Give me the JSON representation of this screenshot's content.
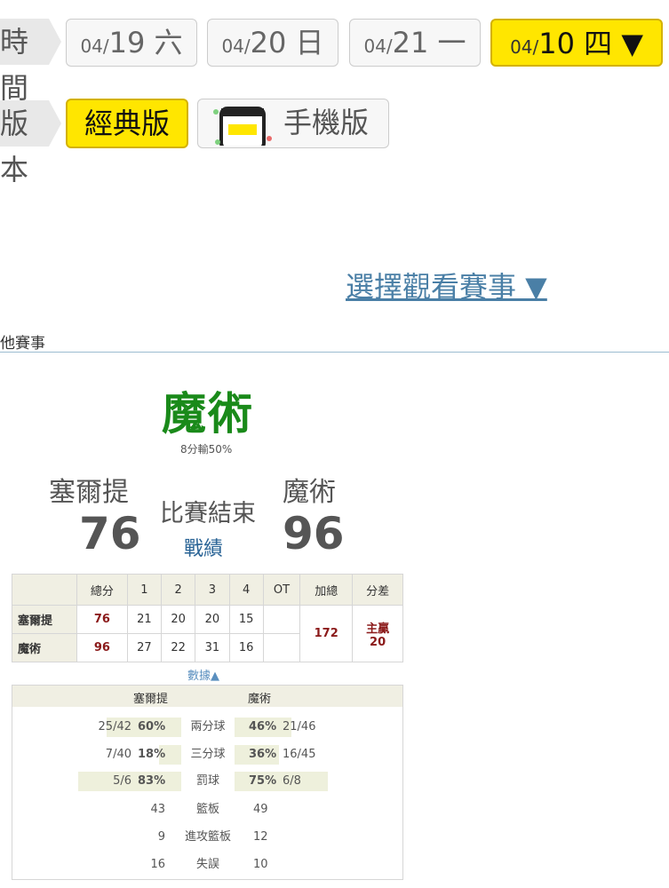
{
  "nav": {
    "time_label": "時間",
    "dates": [
      {
        "md": "04/",
        "day": "19",
        "dow": "六",
        "active": false
      },
      {
        "md": "04/",
        "day": "20",
        "dow": "日",
        "active": false
      },
      {
        "md": "04/",
        "day": "21",
        "dow": "一",
        "active": false
      },
      {
        "md": "04/",
        "day": "10",
        "dow": "四",
        "arrow": "▼",
        "active": true
      }
    ],
    "version_label": "版本",
    "classic_label": "經典版",
    "mobile_label": "手機版"
  },
  "select_game": "選擇觀看賽事 ▼",
  "section_label": "其他賽事",
  "game": {
    "winner": "魔術",
    "winner_note": "8分輸50%",
    "away_team": "塞爾提",
    "home_team": "魔術",
    "away_score": "76",
    "home_score": "96",
    "status": "比賽結束",
    "record_link": "戰績"
  },
  "boxscore": {
    "headers": [
      "",
      "總分",
      "1",
      "2",
      "3",
      "4",
      "OT",
      "加總",
      "分差"
    ],
    "rows": [
      {
        "team": "塞爾提",
        "total": "76",
        "q": [
          "21",
          "20",
          "20",
          "15"
        ],
        "ot": ""
      },
      {
        "team": "魔術",
        "total": "96",
        "q": [
          "27",
          "22",
          "31",
          "16"
        ],
        "ot": ""
      }
    ],
    "combined": "172",
    "diff_label": "主贏",
    "diff_value": "20"
  },
  "stats_toggle": "數據▲",
  "stats": {
    "away": "塞爾提",
    "home": "魔術",
    "rows": [
      {
        "label": "兩分球",
        "away_frac": "25/42",
        "away_pct": "60%",
        "home_pct": "46%",
        "home_frac": "21/46",
        "away_val": 0.6,
        "home_val": 0.46
      },
      {
        "label": "三分球",
        "away_frac": "7/40",
        "away_pct": "18%",
        "home_pct": "36%",
        "home_frac": "16/45",
        "away_val": 0.18,
        "home_val": 0.36
      },
      {
        "label": "罰球",
        "away_frac": "5/6",
        "away_pct": "83%",
        "home_pct": "75%",
        "home_frac": "6/8",
        "away_val": 0.83,
        "home_val": 0.75
      },
      {
        "label": "籃板",
        "away_num": "43",
        "home_num": "49"
      },
      {
        "label": "進攻籃板",
        "away_num": "9",
        "home_num": "12"
      },
      {
        "label": "失誤",
        "away_num": "16",
        "home_num": "10"
      }
    ]
  },
  "colors": {
    "accent_yellow": "#ffe600",
    "winner_green": "#1a8a1a",
    "link_blue": "#4a7fa6",
    "score_red": "#8b1a1a"
  }
}
